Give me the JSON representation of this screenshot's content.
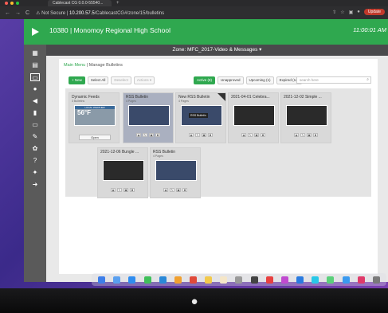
{
  "browser": {
    "tab_title": "Cablecast CG 0.0.0-55540...",
    "security_label": "Not Secure",
    "url_host": "10.200.57.5",
    "url_path": "/CablecastCG#/zone/15/bulletins",
    "update_label": "Update"
  },
  "header": {
    "school_name": "10380 | Monomoy Regional High School",
    "clock": "11:00:01 AM"
  },
  "zone": {
    "label": "Zone: MFC_2017-Video & Messages ▾"
  },
  "breadcrumb": {
    "main_menu": "Main Menu",
    "separator": "|",
    "current": "Manage Bulletins"
  },
  "toolbar": {
    "new_label": "+ New",
    "select_all_label": "Select All",
    "deselect_label": "Deselect",
    "actions_label": "Actions ▾"
  },
  "filters": {
    "active": "Active (8)",
    "unapproved": "Unapproved",
    "upcoming": "Upcoming (1)",
    "expired": "Expired (12)"
  },
  "search": {
    "placeholder": "search here"
  },
  "tooltip": "RSS Bulletin",
  "cards": [
    {
      "title": "Dynamic Feeds",
      "subtitle": "3 Bulletins",
      "open_label": "Open",
      "temp": "56°F",
      "banner": "LOCAL WEATHER",
      "color": "#8a9aa8"
    },
    {
      "title": "RSS Bulletin",
      "subtitle": "4 Pages",
      "color": "#3a4a6a"
    },
    {
      "title": "New RSS Bulletin",
      "subtitle": "4 Pages",
      "color": "#3a4a6a"
    },
    {
      "title": "2021-04-01 Celebra...",
      "subtitle": "",
      "color": "#2a2a2a"
    },
    {
      "title": "2021-12-02 Simple ...",
      "subtitle": "",
      "color": "#2a2a2a"
    },
    {
      "title": "2021-12-06 Bungle ...",
      "subtitle": "",
      "color": "#2a2a2a"
    },
    {
      "title": "RSS Bulletin",
      "subtitle": "4 Pages",
      "color": "#3a4a6a"
    }
  ],
  "colors": {
    "brand_green": "#2fa84f",
    "sidebar": "#5a5a5a",
    "zone_bar": "#4a4a4c"
  }
}
